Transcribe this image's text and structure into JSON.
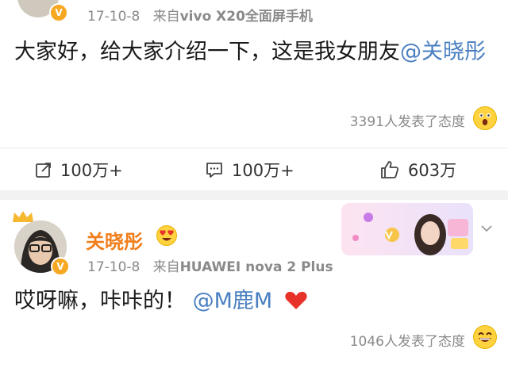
{
  "post1": {
    "timestamp": "17-10-8",
    "source_prefix": "来自",
    "device": "vivo X20全面屏手机",
    "text_before": "大家好，给大家介绍一下，这是我女朋友",
    "mention": "@关晓彤",
    "reactions": "3391人发表了态度",
    "reaction_emoji": "surprised-face",
    "actions": {
      "repost": "100万+",
      "comment": "100万+",
      "like": "603万"
    }
  },
  "post2": {
    "username": "关晓彤",
    "timestamp": "17-10-8",
    "source_prefix": "来自",
    "device": "HUAWEI nova 2 Plus",
    "text_before": "哎呀嘛，咔咔的！",
    "mention": "@M鹿M",
    "reactions": "1046人发表了态度",
    "reaction_emoji": "grinning-face"
  },
  "colors": {
    "mention": "#4a7fc0",
    "username": "#f07e1c",
    "verified_badge": "#f7a823",
    "heart": "#e8332a"
  }
}
